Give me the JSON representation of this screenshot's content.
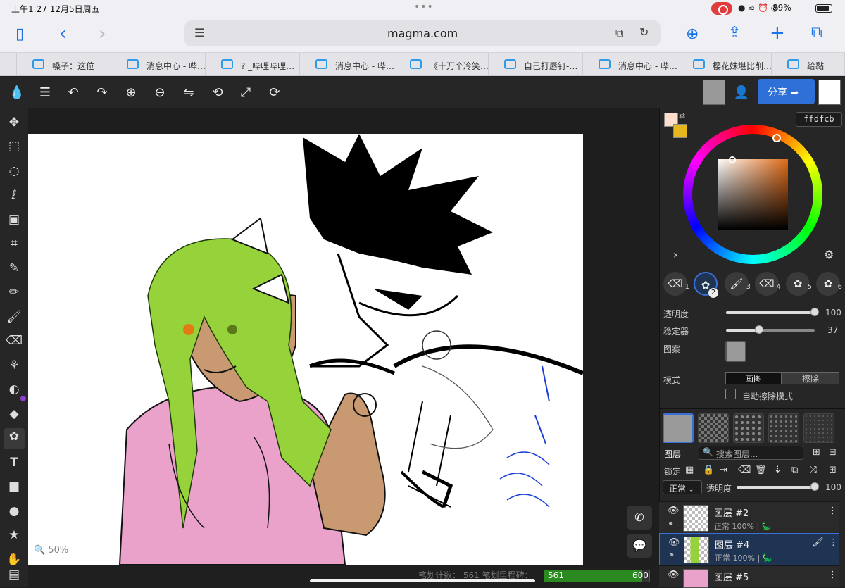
{
  "status": {
    "time": "上午1:27   12月5日周五",
    "battery": "89%",
    "dots": "•••"
  },
  "browser": {
    "url": "magma.com"
  },
  "tabs": [
    "嗓子：这位",
    "消息中心 - 哔…",
    "? _哔哩哔哩…",
    "消息中心 - 哔…",
    "《十万个冷笑…",
    "自己打唇钉-…",
    "消息中心 - 哔…",
    "樱花妹堪比削…",
    "给黏"
  ],
  "app": {
    "share_label": "分享",
    "hex": "ffdfcb",
    "zoom": "50%",
    "colors": {
      "primary": "#ffdfcb",
      "secondary": "#e5b820",
      "accent": "#2e6fd8",
      "progress": "#2a8a1f"
    }
  },
  "brushes": [
    "1",
    "2",
    "3",
    "4",
    "5",
    "6"
  ],
  "props": {
    "opacity_label": "透明度",
    "opacity_value": "100",
    "opacity": 1.0,
    "stabilizer_label": "稳定器",
    "stabilizer_value": "37",
    "stabilizer": 0.37,
    "pattern_label": "图案",
    "mode_label": "模式",
    "mode_draw": "画图",
    "mode_erase": "擦除",
    "auto_erase": "自动擦除模式"
  },
  "layers_panel": {
    "title": "图层",
    "search_placeholder": "搜索图层...",
    "lock_label": "锁定",
    "blend": "正常",
    "opacity_label": "透明度",
    "opacity_value": "100"
  },
  "layers": [
    {
      "name": "图层 #2",
      "sub": "正常 100% |"
    },
    {
      "name": "图层 #4",
      "sub": "正常 100% |"
    },
    {
      "name": "图层 #5",
      "sub": ""
    }
  ],
  "footer": {
    "stroke_count_label": "笔划计数：",
    "stroke_count": "561",
    "limit_label": "笔划里程碑：",
    "progress_value": "561",
    "progress_max": "600",
    "progress": 0.935
  }
}
